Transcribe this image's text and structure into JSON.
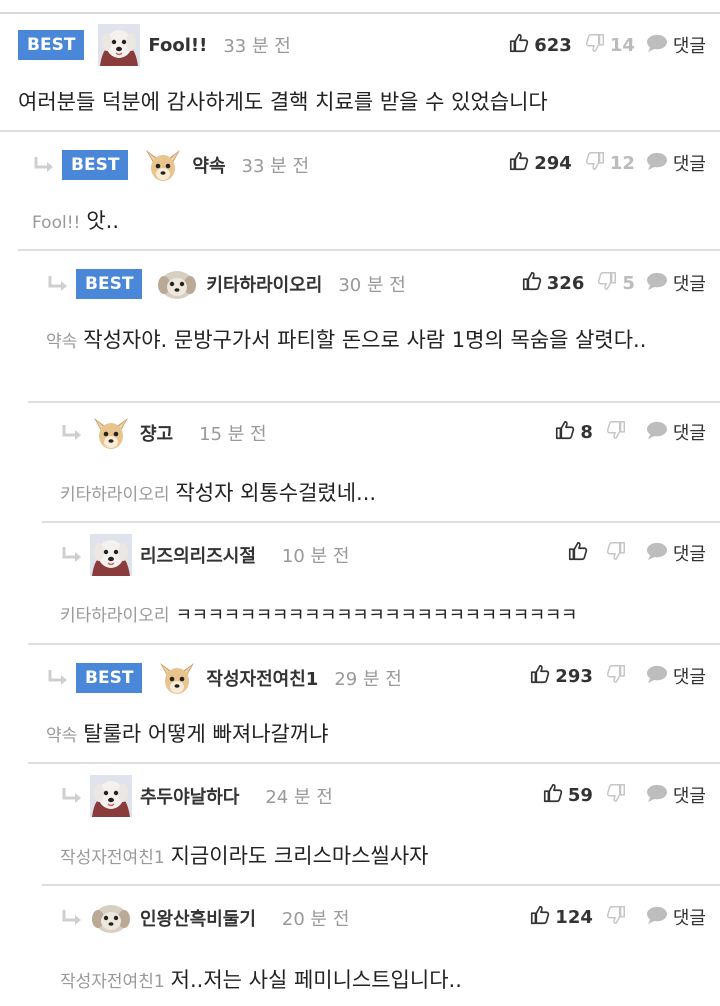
{
  "comments": [
    {
      "best": true,
      "best_label": "BEST",
      "avatar": "maltese-dog-avatar",
      "author": "Fool!!",
      "time": "33 분 전",
      "likes": "623",
      "dislikes": "14",
      "reply_label": "댓글",
      "mention": "",
      "text": "여러분들 덕분에 감사하게도 결핵 치료를 받을 수 있었습니다"
    },
    {
      "best": true,
      "best_label": "BEST",
      "avatar": "chihuahua-avatar",
      "author": "약속",
      "time": "33 분 전",
      "likes": "294",
      "dislikes": "12",
      "reply_label": "댓글",
      "mention": "Fool!!",
      "text": "앗.."
    },
    {
      "best": true,
      "best_label": "BEST",
      "avatar": "puppy-face-avatar",
      "author": "키타하라이오리",
      "time": "30 분 전",
      "likes": "326",
      "dislikes": "5",
      "reply_label": "댓글",
      "mention": "약속",
      "text": "작성자야. 문방구가서 파티할 돈으로 사람 1명의 목숨을 살렷다.."
    },
    {
      "best": false,
      "avatar": "chihuahua-avatar",
      "author": "쟝고",
      "time": "15 분 전",
      "likes": "8",
      "dislikes": "",
      "reply_label": "댓글",
      "mention": "키타하라이오리",
      "text": "작성자 외통수걸렸네..."
    },
    {
      "best": false,
      "avatar": "maltese-dog-avatar",
      "author": "리즈의리즈시절",
      "time": "10 분 전",
      "likes": "",
      "dislikes": "",
      "reply_label": "댓글",
      "mention": "키타하라이오리",
      "text": "ㅋㅋㅋㅋㅋㅋㅋㅋㅋㅋㅋㅋㅋㅋㅋㅋㅋㅋㅋㅋㅋㅋㅋㅋㅋ"
    },
    {
      "best": true,
      "best_label": "BEST",
      "avatar": "chihuahua-avatar",
      "author": "작성자전여친1",
      "time": "29 분 전",
      "likes": "293",
      "dislikes": "",
      "reply_label": "댓글",
      "mention": "약속",
      "text": "탈룰라 어떻게 빠져나갈꺼냐"
    },
    {
      "best": false,
      "avatar": "maltese-dog-avatar",
      "author": "추두야날하다",
      "time": "24 분 전",
      "likes": "59",
      "dislikes": "",
      "reply_label": "댓글",
      "mention": "작성자전여친1",
      "text": "지금이라도 크리스마스씰사자"
    },
    {
      "best": false,
      "avatar": "puppy-face-avatar",
      "author": "인왕산흑비둘기",
      "time": "20 분 전",
      "likes": "124",
      "dislikes": "",
      "reply_label": "댓글",
      "mention": "작성자전여친1",
      "text": "저..저는 사실 페미니스트입니다.."
    }
  ]
}
